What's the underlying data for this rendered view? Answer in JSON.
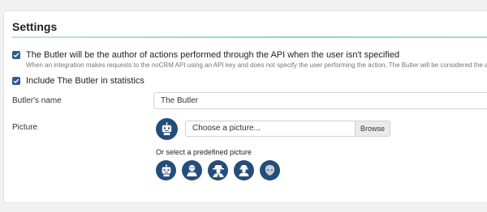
{
  "panel": {
    "title": "Settings"
  },
  "author_option": {
    "checked": true,
    "label": "The Butler will be the author of actions performed through the API when the user isn't specified",
    "help": "When an integration makes requests to the noCRM API using an API key and does not specify the user performing the action, The Butler will be considered the author."
  },
  "stats_option": {
    "checked": true,
    "label": "Include The Butler in statistics"
  },
  "name_field": {
    "label": "Butler's name",
    "value": "The Butler"
  },
  "picture_field": {
    "label": "Picture",
    "file_placeholder": "Choose a picture...",
    "browse_label": "Browse",
    "current_avatar_icon": "robot-avatar-icon"
  },
  "predefined": {
    "label": "Or select a predefined picture",
    "avatars": [
      "robot-avatar-icon",
      "butler-avatar-icon",
      "detective-avatar-icon",
      "worker-avatar-icon",
      "alien-avatar-icon"
    ]
  },
  "colors": {
    "checkbox": "#2f5a8a",
    "avatar_bg": "#244d7a",
    "accent_rule": "#8fd3c4"
  }
}
